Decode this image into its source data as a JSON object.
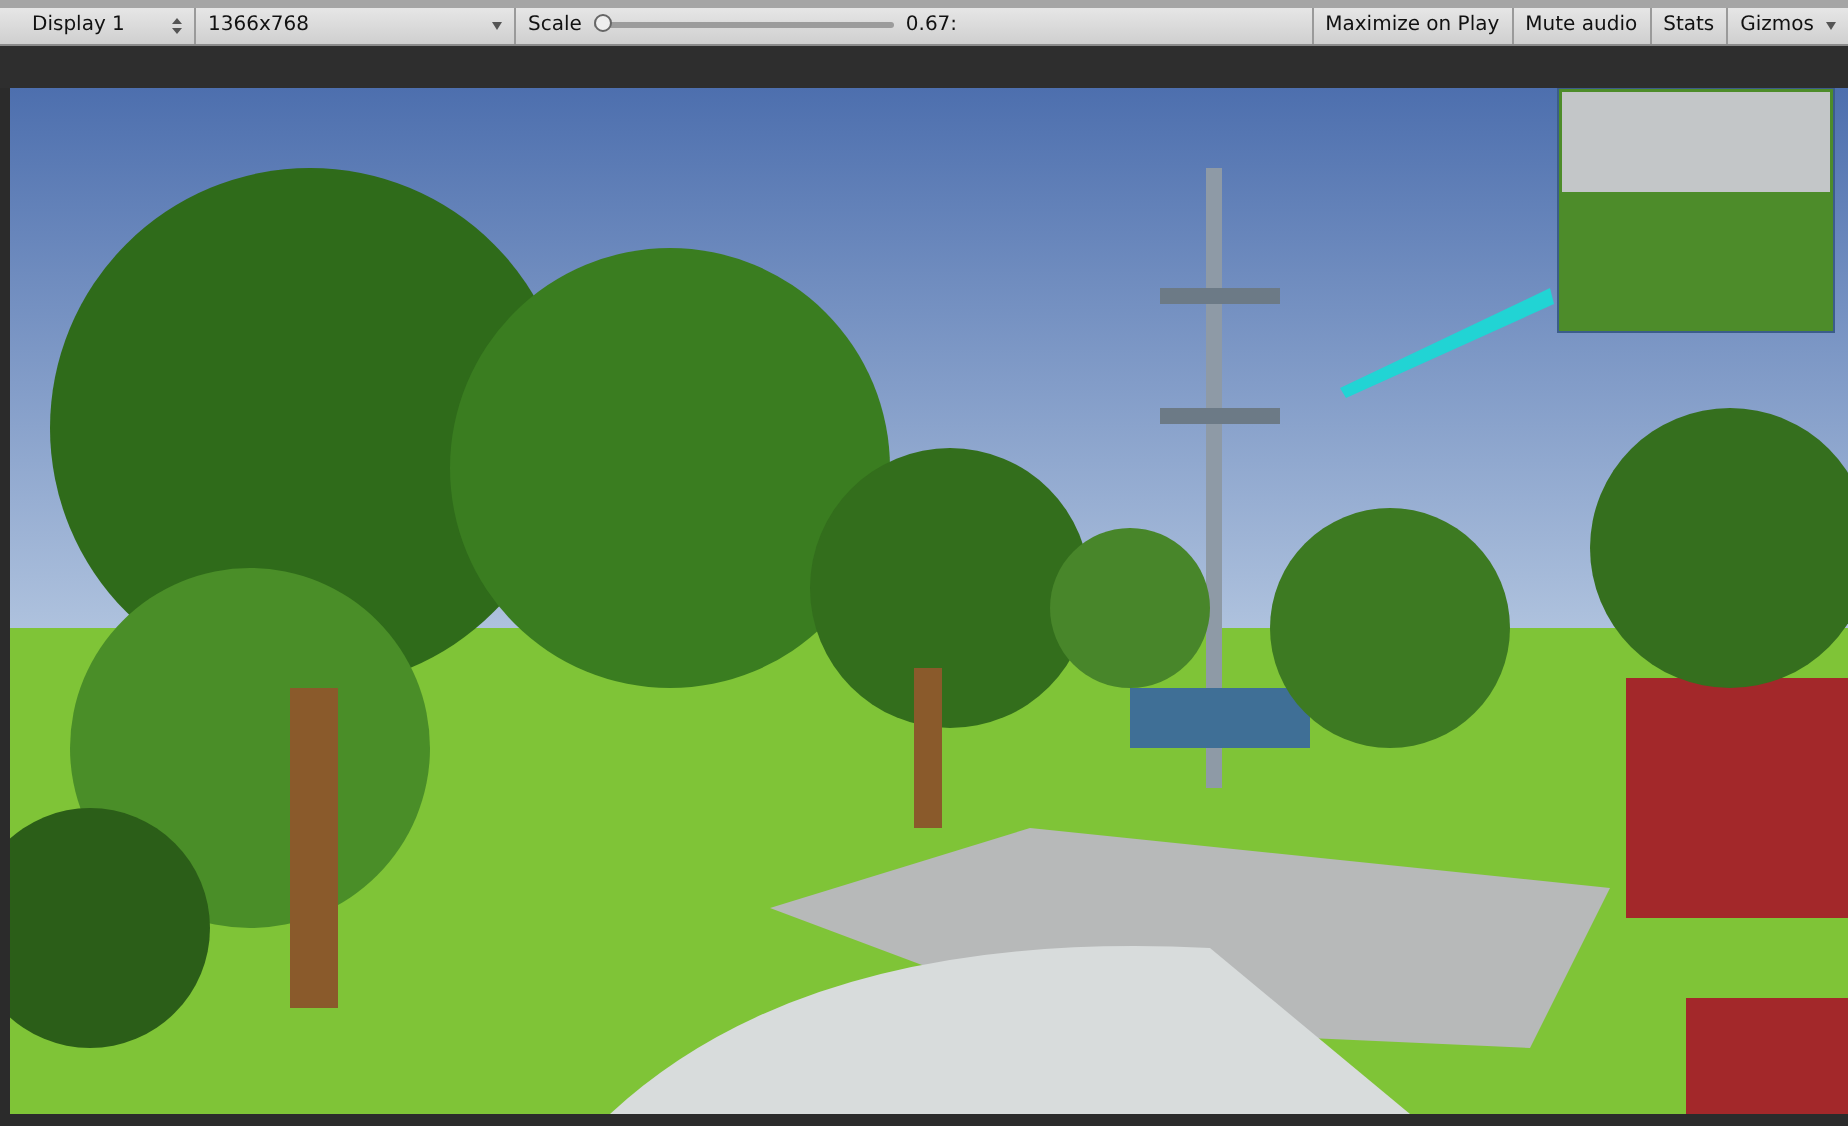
{
  "toolbar": {
    "display": "Display 1",
    "resolution": "1366x768",
    "scale": {
      "label": "Scale",
      "level": 0.0,
      "reading": "0.67:"
    },
    "buttons": [
      "Maximize on Play",
      "Mute audio",
      "Stats",
      "Gizmos"
    ]
  }
}
